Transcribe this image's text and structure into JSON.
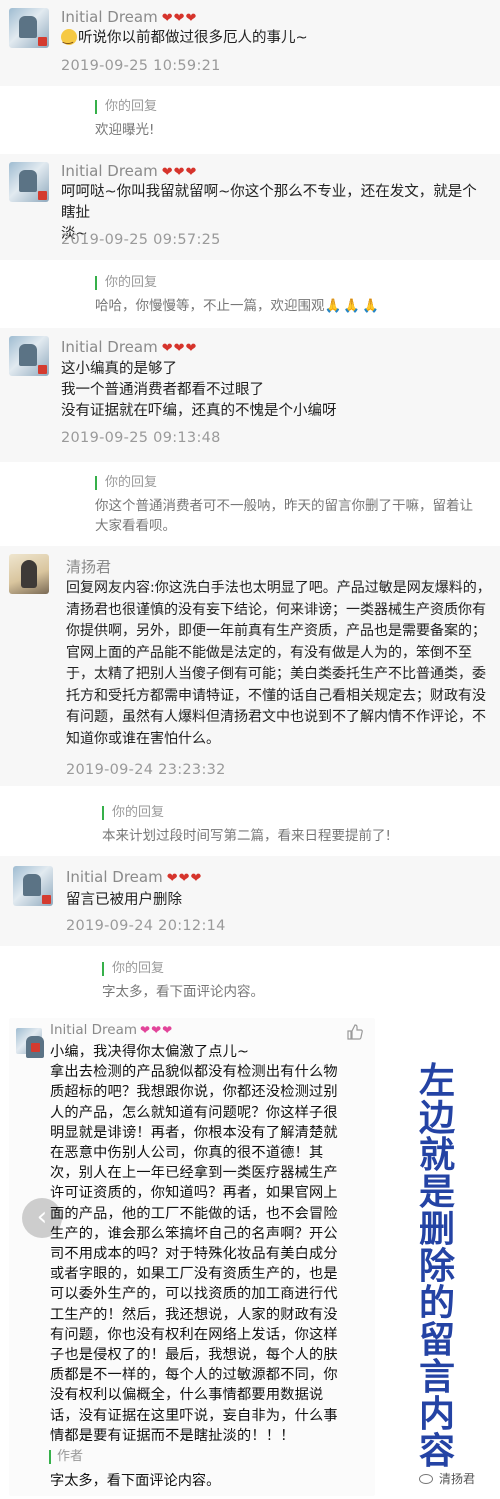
{
  "comments": [
    {
      "name": "Initial Dream",
      "badge": "❤❤❤",
      "lines": [
        "听说你以前都做过很多厄人的事儿~"
      ],
      "time": "2019-09-25 10:59:21",
      "reply_label": "你的回复",
      "reply_lines": [
        "欢迎曝光!"
      ]
    },
    {
      "name": "Initial Dream",
      "badge": "❤❤❤",
      "lines": [
        "呵呵哒~你叫我留就留啊~你这个那么不专业，还在发文，就是个瞎扯",
        "淡~"
      ],
      "time": "2019-09-25 09:57:25",
      "reply_label": "你的回复",
      "reply_lines": [
        "哈哈，你慢慢等，不止一篇，欢迎围观"
      ],
      "reply_emoji": "🙏🙏🙏"
    },
    {
      "name": "Initial Dream",
      "badge": "❤❤❤",
      "lines": [
        "这小编真的是够了",
        "我一个普通消费者都看不过眼了",
        "没有证据就在吓编，还真的不愧是个小编呀"
      ],
      "time": "2019-09-25 09:13:48",
      "reply_label": "你的回复",
      "reply_lines": [
        "你这个普通消费者可不一般呐，昨天的留言你删了干嘛，留着让",
        "大家看看呗。"
      ]
    },
    {
      "name": "清扬君",
      "lines": [
        "回复网友内容:你这洗白手法也太明显了吧。产品过敏是网友爆料的，",
        "清扬君也很谨慎的没有妄下结论，何来诽谤；一类器械生产资质你有",
        "你提供啊，另外，即便一年前真有生产资质，产品也是需要备案的；",
        "官网上面的产品能不能做是法定的，有没有做是人为的，笨倒不至",
        "于，太精了把别人当傻子倒有可能；美白类委托生产不比普通类，委",
        "托方和受托方都需申请特证，不懂的话自己看相关规定去；财政有没",
        "有问题，虽然有人爆料但清扬君文中也说到不了解内情不作评论，不",
        "知道你或谁在害怕什么。"
      ],
      "time": "2019-09-24 23:23:32",
      "reply_label": "你的回复",
      "reply_lines": [
        "本来计划过段时间写第二篇，看来日程要提前了!"
      ]
    },
    {
      "name": "Initial Dream",
      "badge": "❤❤❤",
      "lines": [
        "留言已被用户删除"
      ],
      "time": "2019-09-24 20:12:14",
      "reply_label": "你的回复",
      "reply_lines": [
        "字太多，看下面评论内容。"
      ]
    }
  ],
  "deleted_comment": {
    "name": "Initial Dream",
    "badge": "❤❤❤",
    "like_icon": "thumbs-up-icon",
    "lines": [
      "小编，我决得你太偏激了点儿~",
      "拿出去检测的产品貌似都没有检测出有什么物",
      "质超标的吧？我想跟你说，你都还没检测过别",
      "人的产品，怎么就知道有问题呢？你这样子很",
      "明显就是诽谤！再者，你根本没有了解清楚就",
      "在恶意中伤别人公司，你真的很不道德！其",
      "次，别人在上一年已经拿到一类医疗器械生产",
      "许可证资质的，你知道吗？再者，如果官网上",
      "面的产品，他的工厂不能做的话，也不会冒险",
      "生产的，谁会那么笨搞坏自己的名声啊？开公",
      "司不用成本的吗？对于特殊化妆品有美白成分",
      "或者字眼的，如果工厂没有资质生产的，也是",
      "可以委外生产的，可以找资质的加工商进行代",
      "工生产的！然后，我还想说，人家的财政有没",
      "有问题，你也没有权利在网络上发话，你这样",
      "子也是侵权了的！最后，我想说，每个人的肤",
      "质都是不一样的，每个人的过敏源都不同，你",
      "没有权利以偏概全，什么事情都要用数据说",
      "话，没有证据在这里吓说，妄自非为，什么事",
      "情都是要有证据而不是瞎扯淡的！！！"
    ],
    "author_label": "作者",
    "author_text": "字太多，看下面评论内容。",
    "back_icon": "chevron-left-icon"
  },
  "side_note": "左边就是删除的留言内容",
  "watermark": "清扬君",
  "colors": {
    "accent_green": "#36b04a",
    "note_blue": "#2443a4",
    "heart_red": "#d6342c"
  }
}
